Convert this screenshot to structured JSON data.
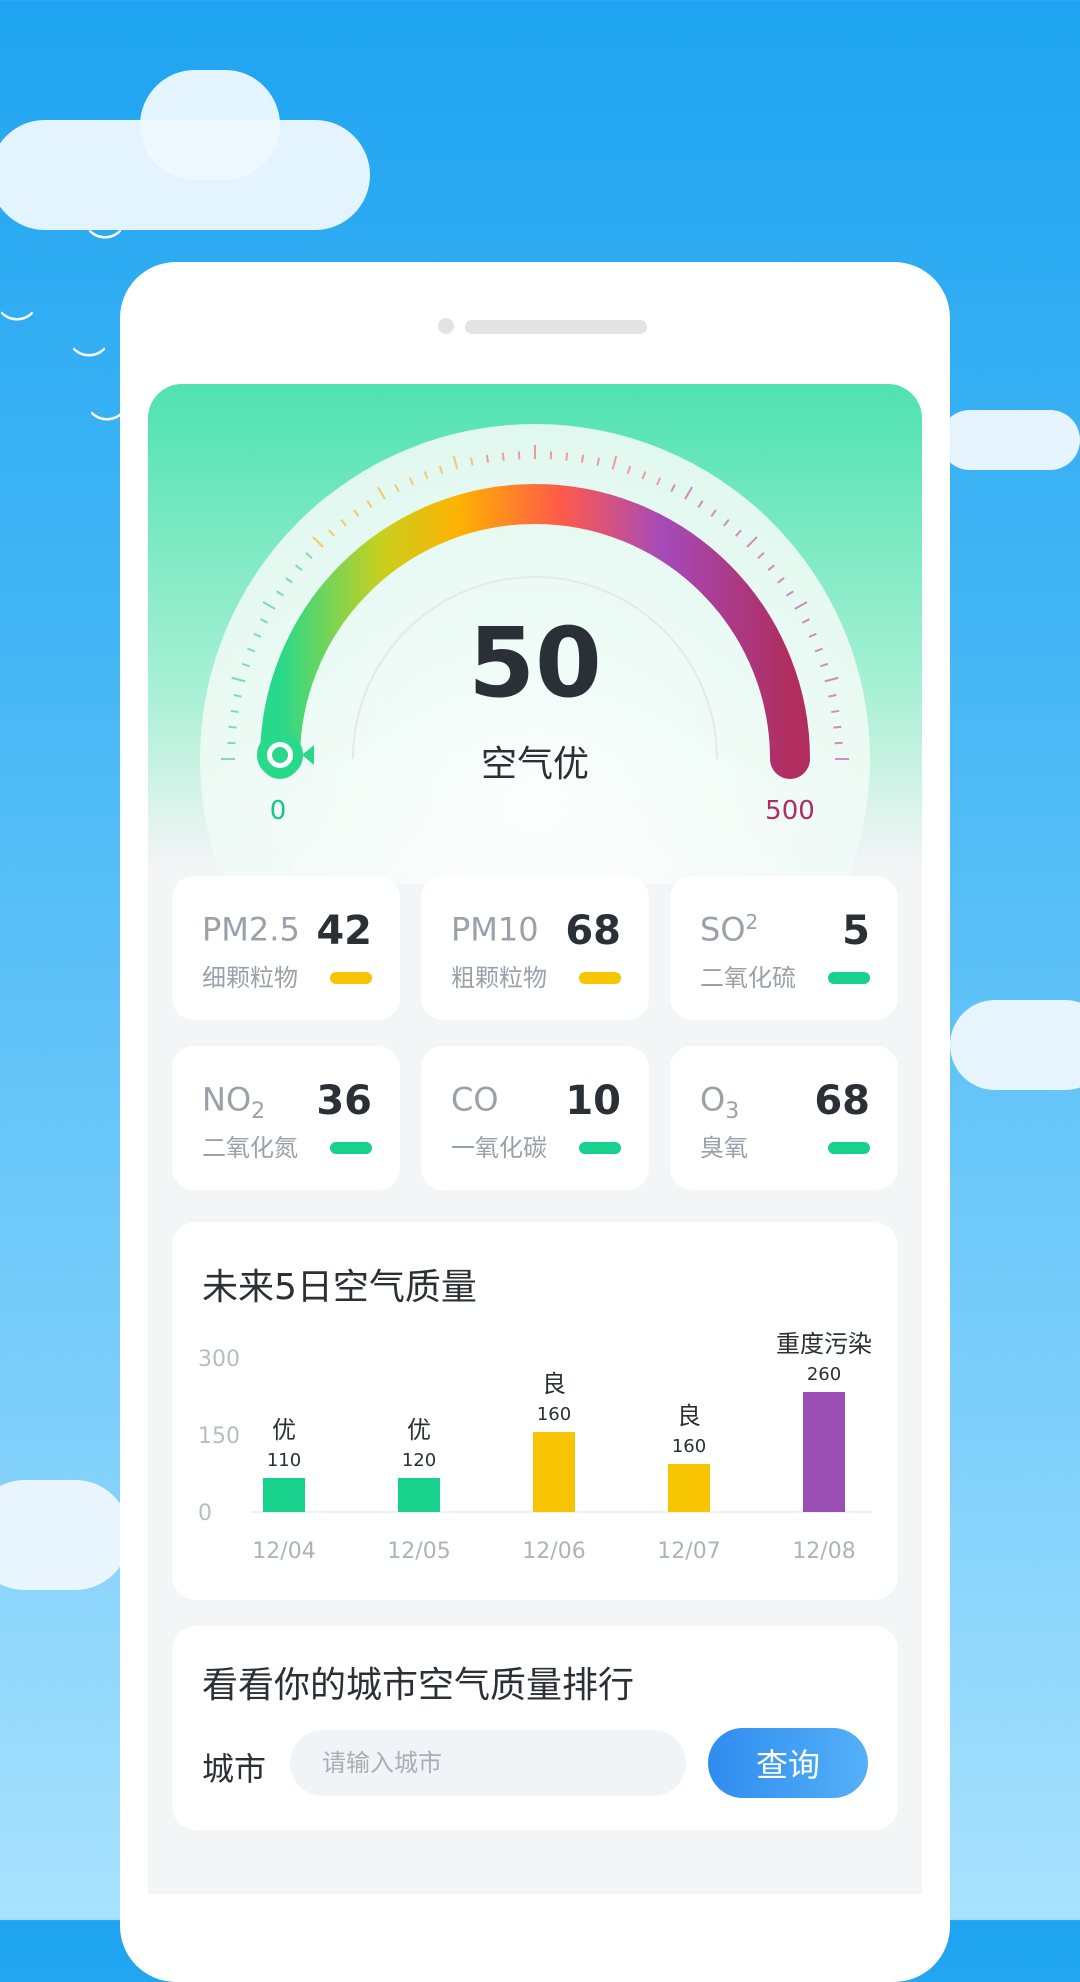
{
  "colors": {
    "excellent": "#17d18d",
    "good": "#f6c400",
    "severe": "#9b4fb4",
    "max_label": "#b02d5e",
    "min_label": "#17c489"
  },
  "gauge": {
    "value": "50",
    "status": "空气优",
    "min_label": "0",
    "max_label": "500",
    "min": 0,
    "max": 500
  },
  "pollutants": [
    {
      "name": "PM2.5",
      "sup": "",
      "sub": "",
      "cn": "细颗粒物",
      "value": "42",
      "level": "good"
    },
    {
      "name": "PM10",
      "sup": "",
      "sub": "",
      "cn": "粗颗粒物",
      "value": "68",
      "level": "good"
    },
    {
      "name": "SO",
      "sup": "2",
      "sub": "",
      "cn": "二氧化硫",
      "value": "5",
      "level": "excellent"
    },
    {
      "name": "NO",
      "sup": "",
      "sub": "2",
      "cn": "二氧化氮",
      "value": "36",
      "level": "excellent"
    },
    {
      "name": "CO",
      "sup": "",
      "sub": "",
      "cn": "一氧化碳",
      "value": "10",
      "level": "excellent"
    },
    {
      "name": "O",
      "sup": "",
      "sub": "3",
      "cn": "臭氧",
      "value": "68",
      "level": "excellent"
    }
  ],
  "forecast": {
    "title": "未来5日空气质量"
  },
  "chart_data": {
    "type": "bar",
    "categories": [
      "12/04",
      "12/05",
      "12/06",
      "12/07",
      "12/08"
    ],
    "values": [
      110,
      120,
      160,
      160,
      260
    ],
    "quality_labels": [
      "优",
      "优",
      "良",
      "良",
      "重度污染"
    ],
    "levels": [
      "excellent",
      "excellent",
      "good",
      "good",
      "severe"
    ],
    "ylim": [
      0,
      300
    ],
    "yticks": [
      "300",
      "150",
      "0"
    ],
    "grid": false
  },
  "ranking": {
    "title": "看看你的城市空气质量排行",
    "city_label": "城市",
    "placeholder": "请输入城市",
    "button": "查询"
  }
}
